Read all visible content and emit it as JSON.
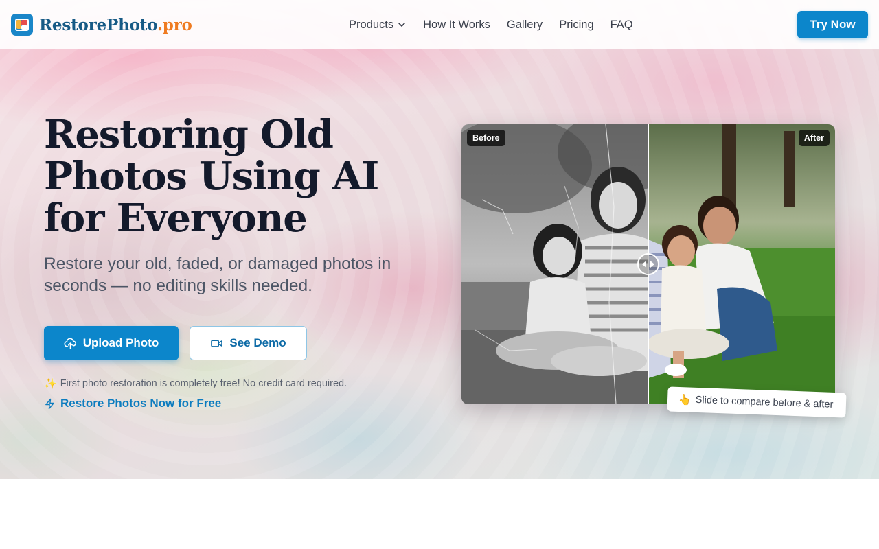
{
  "brand": {
    "name": "RestorePhoto",
    "tld": ".pro"
  },
  "nav": {
    "items": [
      {
        "label": "Products",
        "dropdown": true
      },
      {
        "label": "How It Works"
      },
      {
        "label": "Gallery"
      },
      {
        "label": "Pricing"
      },
      {
        "label": "FAQ"
      }
    ],
    "cta": "Try Now"
  },
  "hero": {
    "title": "Restoring Old Photos Using AI for Everyone",
    "subtitle": "Restore your old, faded, or damaged photos in seconds — no editing skills needed.",
    "upload_label": "Upload Photo",
    "demo_label": "See Demo",
    "free_note": "First photo restoration is completely free! No credit card required.",
    "free_link": "Restore Photos Now for Free"
  },
  "compare": {
    "before_label": "Before",
    "after_label": "After",
    "hint": "Slide to compare before & after",
    "slider_position": 0.5
  },
  "colors": {
    "primary": "#0c86cb",
    "brand_text": "#175a85",
    "tld_orange": "#ef7b21",
    "heading": "#141a2b"
  },
  "icons": {
    "upload": "cloud-upload-icon",
    "demo": "video-icon",
    "lightning": "lightning-icon",
    "sparkle": "sparkles-icon",
    "pointer": "pointing-hand-icon"
  }
}
